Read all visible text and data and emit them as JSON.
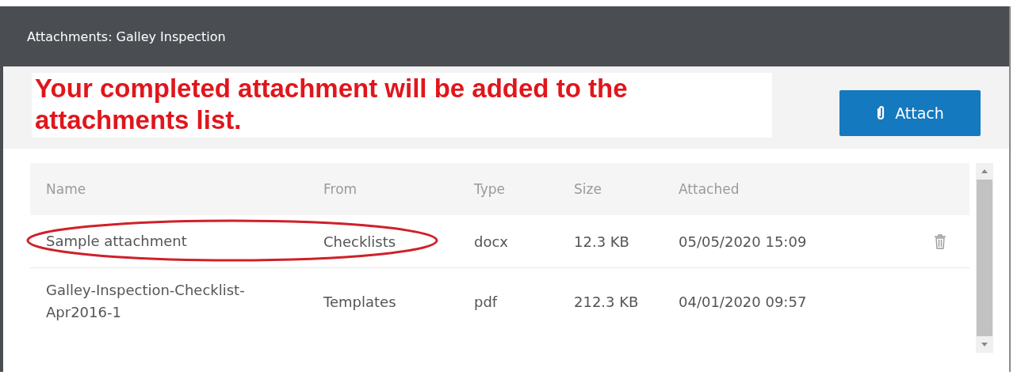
{
  "dialog": {
    "title": "Attachments: Galley Inspection"
  },
  "annotation": "Your completed attachment will be added to the attachments list.",
  "attach_button": "Attach",
  "table": {
    "columns": [
      "Name",
      "From",
      "Type",
      "Size",
      "Attached"
    ],
    "rows": [
      {
        "cells": [
          "Sample attachment",
          "Checklists",
          "docx",
          "12.3 KB",
          "05/05/2020 15:09"
        ],
        "circled": true,
        "deletable": true
      },
      {
        "cells": [
          "Galley-Inspection-Checklist-Apr2016-1",
          "Templates",
          "pdf",
          "212.3 KB",
          "04/01/2020 09:57"
        ],
        "circled": false,
        "deletable": false
      }
    ]
  }
}
